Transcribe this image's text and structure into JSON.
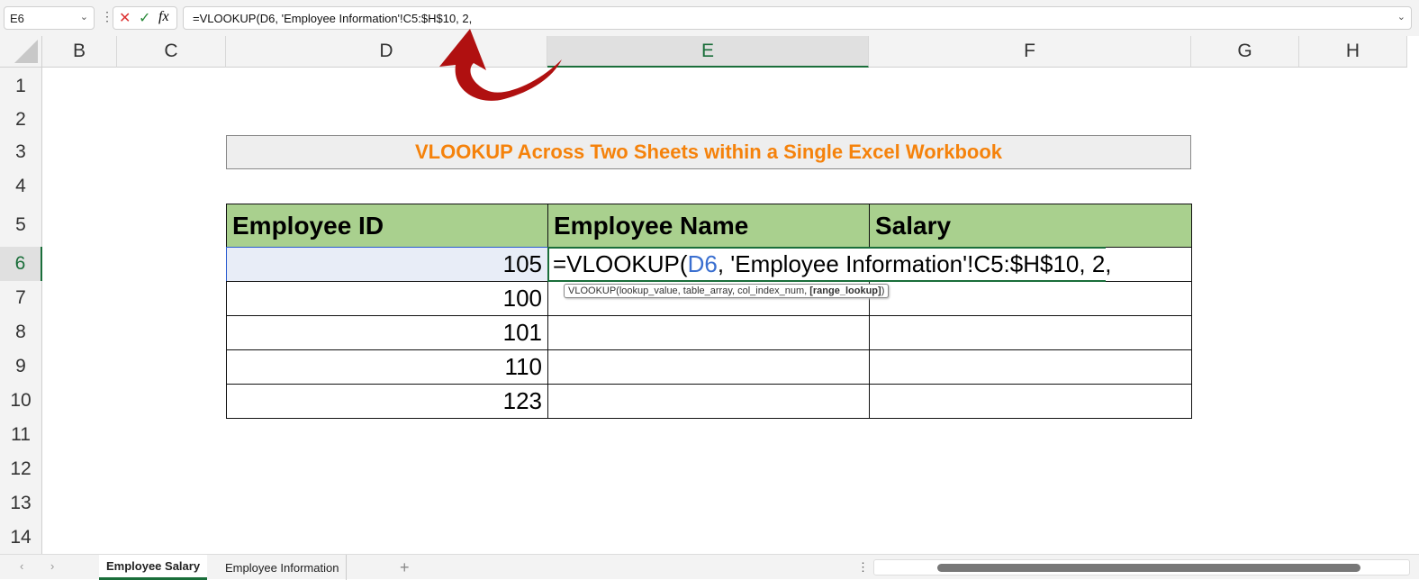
{
  "formula_bar": {
    "name_box": "E6",
    "formula": "=VLOOKUP(D6, 'Employee Information'!C5:$H$10, 2,",
    "cancel_icon": "✕",
    "enter_icon": "✓",
    "fx_label": "fx"
  },
  "columns": [
    "B",
    "C",
    "D",
    "E",
    "F",
    "G",
    "H"
  ],
  "rows": [
    "1",
    "2",
    "3",
    "4",
    "5",
    "6",
    "7",
    "8",
    "9",
    "10",
    "11",
    "12",
    "13",
    "14"
  ],
  "title": "VLOOKUP Across Two Sheets within a Single Excel Workbook",
  "table": {
    "headers": [
      "Employee ID",
      "Employee Name",
      "Salary"
    ],
    "ids": [
      "105",
      "100",
      "101",
      "110",
      "123"
    ]
  },
  "editing": {
    "prefix": "=VLOOKUP(",
    "ref": "D6",
    "rest": ", 'Employee Information'!C5:$H$10, 2,"
  },
  "tooltip": {
    "text": "VLOOKUP(lookup_value, table_array, col_index_num, ",
    "bold": "[range_lookup]",
    "end": ")"
  },
  "sheets": {
    "active": "Employee Salary",
    "other": "Employee Information",
    "add": "+"
  },
  "colors": {
    "accent": "#1a6e3a",
    "title": "#f5820b",
    "header_fill": "#a9d08e",
    "arrow": "#b01010"
  }
}
